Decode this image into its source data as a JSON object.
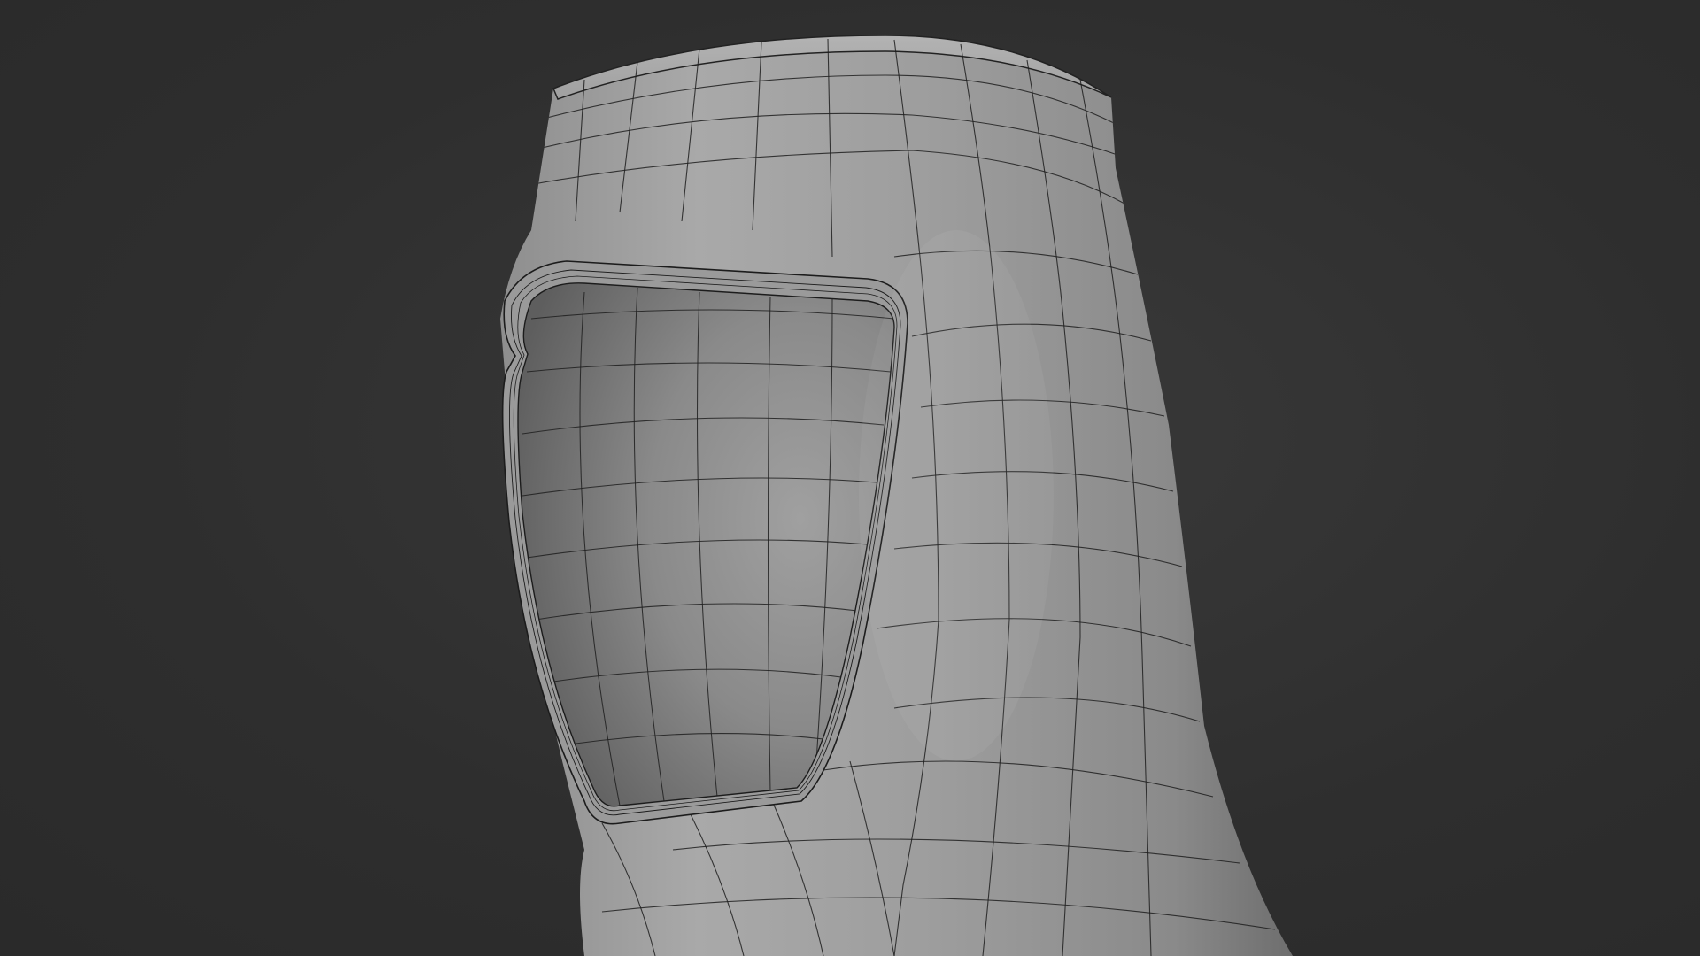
{
  "viewport": {
    "background_color": "#2f2f2f",
    "subject": "hood-mesh",
    "shading": "solid-gray-with-wireframe-overlay",
    "mesh_color": "#a3a3a3",
    "wire_color": "#1a1a1a"
  }
}
